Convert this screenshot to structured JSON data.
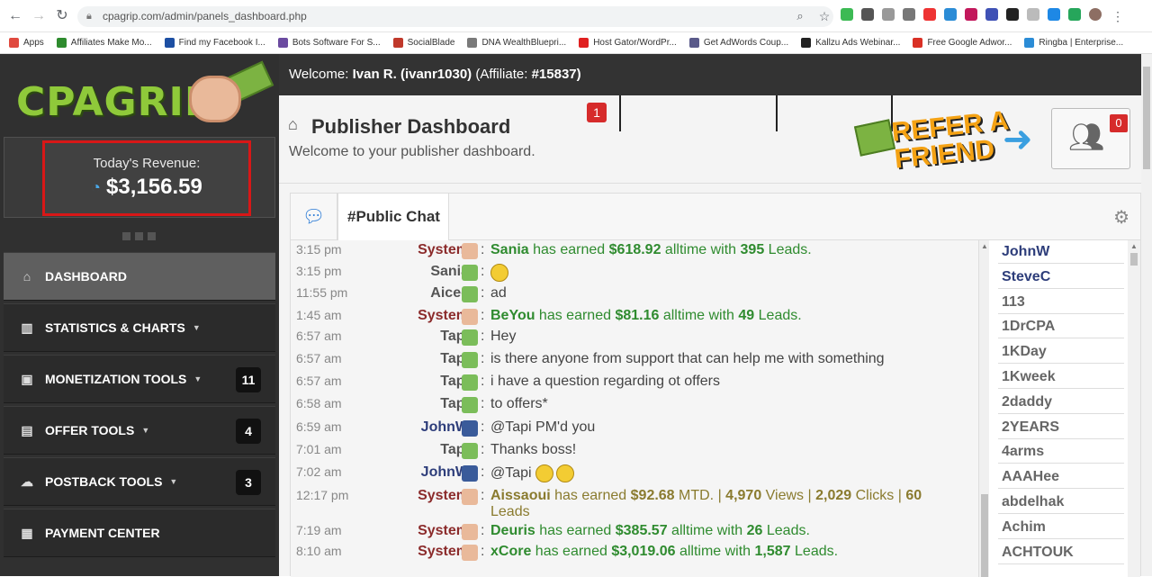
{
  "browser": {
    "url": "cpagrip.com/admin/panels_dashboard.php",
    "bookmarks": [
      {
        "label": "Apps",
        "color": "#e04a3f"
      },
      {
        "label": "Affiliates Make Mo...",
        "color": "#2e8b2e"
      },
      {
        "label": "Find my Facebook I...",
        "color": "#1d4fa3"
      },
      {
        "label": "Bots Software For S...",
        "color": "#6b4ba0"
      },
      {
        "label": "SocialBlade",
        "color": "#c0392b"
      },
      {
        "label": "DNA WealthBlueprі...",
        "color": "#7a7a7a"
      },
      {
        "label": "Host Gator/WordPr...",
        "color": "#e02020"
      },
      {
        "label": "Get AdWords Coup...",
        "color": "#5a5a8a"
      },
      {
        "label": "Kallzu Ads Webinar...",
        "color": "#222222"
      },
      {
        "label": "Free Google Adwor...",
        "color": "#d93025"
      },
      {
        "label": "Ringba | Enterprise...",
        "color": "#2b8cd6"
      }
    ]
  },
  "sidebar": {
    "logo_text": "CPAGRIP",
    "revenue_label": "Today's Revenue:",
    "revenue_value": "$3,156.59",
    "menu": [
      {
        "label": "DASHBOARD",
        "icon": "home-icon",
        "caret": false,
        "count": null,
        "active": true
      },
      {
        "label": "STATISTICS & CHARTS",
        "icon": "bar-chart-icon",
        "caret": true,
        "count": null,
        "active": false
      },
      {
        "label": "MONETIZATION TOOLS",
        "icon": "monitor-icon",
        "caret": true,
        "count": "11",
        "active": false
      },
      {
        "label": "OFFER TOOLS",
        "icon": "clipboard-icon",
        "caret": true,
        "count": "4",
        "active": false
      },
      {
        "label": "POSTBACK TOOLS",
        "icon": "cloud-icon",
        "caret": true,
        "count": "3",
        "active": false
      },
      {
        "label": "PAYMENT CENTER",
        "icon": "money-icon",
        "caret": false,
        "count": null,
        "active": false
      }
    ]
  },
  "topbar": {
    "welcome": "Welcome:",
    "user": "Ivan R. (ivanr1030)",
    "affiliate": "(Affiliate:",
    "affiliate_id": "#15837)"
  },
  "header": {
    "title": "Publisher Dashboard",
    "subtitle": "Welcome to your publisher dashboard.",
    "notification_count": "1",
    "refer_text": "REFER A FRIEND",
    "friends_count": "0"
  },
  "chat": {
    "tab_label": "#Public Chat",
    "messages": [
      {
        "time": "3:15 pm",
        "user": "System",
        "type": "sys",
        "avatar": "fist",
        "segments": [
          {
            "t": "Sania",
            "hl": true
          },
          {
            "t": " has earned "
          },
          {
            "t": "$618.92",
            "hl": true
          },
          {
            "t": " alltime with "
          },
          {
            "t": "395",
            "hl": true
          },
          {
            "t": " Leads."
          }
        ],
        "style": "earned"
      },
      {
        "time": "3:15 pm",
        "user": "Sania",
        "type": "user",
        "avatar": "green",
        "segments": [
          {
            "t": "",
            "emoji": 1
          }
        ],
        "style": "plain"
      },
      {
        "time": "11:55 pm",
        "user": "Aicec",
        "type": "user",
        "avatar": "green",
        "segments": [
          {
            "t": "ad"
          }
        ],
        "style": "plain"
      },
      {
        "time": "1:45 am",
        "user": "System",
        "type": "sys",
        "avatar": "fist",
        "segments": [
          {
            "t": "BeYou",
            "hl": true
          },
          {
            "t": " has earned "
          },
          {
            "t": "$81.16",
            "hl": true
          },
          {
            "t": " alltime with "
          },
          {
            "t": "49",
            "hl": true
          },
          {
            "t": " Leads."
          }
        ],
        "style": "earned"
      },
      {
        "time": "6:57 am",
        "user": "Tapi",
        "type": "user",
        "avatar": "green",
        "segments": [
          {
            "t": "Hey"
          }
        ],
        "style": "plain"
      },
      {
        "time": "6:57 am",
        "user": "Tapi",
        "type": "user",
        "avatar": "green",
        "segments": [
          {
            "t": "is there anyone from support that can help me with something"
          }
        ],
        "style": "plain"
      },
      {
        "time": "6:57 am",
        "user": "Tapi",
        "type": "user",
        "avatar": "green",
        "segments": [
          {
            "t": "i have a question regarding ot offers"
          }
        ],
        "style": "plain"
      },
      {
        "time": "6:58 am",
        "user": "Tapi",
        "type": "user",
        "avatar": "green",
        "segments": [
          {
            "t": "to offers*"
          }
        ],
        "style": "plain"
      },
      {
        "time": "6:59 am",
        "user": "JohnW",
        "type": "blue",
        "avatar": "blue",
        "segments": [
          {
            "t": "@Tapi PM'd you"
          }
        ],
        "style": "plain"
      },
      {
        "time": "7:01 am",
        "user": "Tapi",
        "type": "user",
        "avatar": "green",
        "segments": [
          {
            "t": "Thanks boss!"
          }
        ],
        "style": "plain"
      },
      {
        "time": "7:02 am",
        "user": "JohnW",
        "type": "blue",
        "avatar": "blue",
        "segments": [
          {
            "t": "@Tapi "
          },
          {
            "t": "",
            "emoji": 2
          }
        ],
        "style": "plain"
      },
      {
        "time": "12:17 pm",
        "user": "System",
        "type": "sys",
        "avatar": "fist",
        "segments": [
          {
            "t": "Aissaoui",
            "hl": true
          },
          {
            "t": " has earned "
          },
          {
            "t": "$92.68",
            "hl": true
          },
          {
            "t": " MTD. | "
          },
          {
            "t": "4,970",
            "hl": true
          },
          {
            "t": " Views | "
          },
          {
            "t": "2,029",
            "hl": true
          },
          {
            "t": " Clicks | "
          },
          {
            "t": "60",
            "hl": true
          },
          {
            "t": " Leads"
          }
        ],
        "style": "earned-o"
      },
      {
        "time": "7:19 am",
        "user": "System",
        "type": "sys",
        "avatar": "fist",
        "segments": [
          {
            "t": "Deuris",
            "hl": true
          },
          {
            "t": " has earned "
          },
          {
            "t": "$385.57",
            "hl": true
          },
          {
            "t": " alltime with "
          },
          {
            "t": "26",
            "hl": true
          },
          {
            "t": " Leads."
          }
        ],
        "style": "earned"
      },
      {
        "time": "8:10 am",
        "user": "System",
        "type": "sys",
        "avatar": "fist",
        "segments": [
          {
            "t": "xCore",
            "hl": true
          },
          {
            "t": " has earned "
          },
          {
            "t": "$3,019.06",
            "hl": true
          },
          {
            "t": " alltime with "
          },
          {
            "t": "1,587",
            "hl": true
          },
          {
            "t": " Leads."
          }
        ],
        "style": "earned"
      }
    ],
    "users": [
      {
        "name": "JohnW",
        "bold": true
      },
      {
        "name": "SteveC",
        "bold": true
      },
      {
        "name": "113",
        "bold": false
      },
      {
        "name": "1DrCPA",
        "bold": false
      },
      {
        "name": "1KDay",
        "bold": false
      },
      {
        "name": "1Kweek",
        "bold": false
      },
      {
        "name": "2daddy",
        "bold": false
      },
      {
        "name": "2YEARS",
        "bold": false
      },
      {
        "name": "4arms",
        "bold": false
      },
      {
        "name": "AAAHee",
        "bold": false
      },
      {
        "name": "abdelhak",
        "bold": false
      },
      {
        "name": "Achim",
        "bold": false
      },
      {
        "name": "ACHTOUK",
        "bold": false
      }
    ]
  }
}
